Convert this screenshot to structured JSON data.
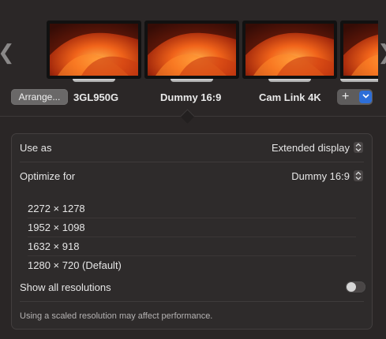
{
  "displays": {
    "items": [
      {
        "label": "3GL950G"
      },
      {
        "label": "Dummy 16:9"
      },
      {
        "label": "Cam Link 4K"
      }
    ],
    "arrange_label": "Arrange...",
    "add_symbol": "+",
    "left_arrow": "❮",
    "right_arrow": "❯",
    "selected": "Dummy 16:9"
  },
  "settings": {
    "use_as": {
      "label": "Use as",
      "value": "Extended display"
    },
    "optimize_for": {
      "label": "Optimize for",
      "value": "Dummy 16:9"
    },
    "resolutions": [
      "2272 × 1278",
      "1952 × 1098",
      "1632 × 918",
      "1280 × 720 (Default)"
    ],
    "show_all": {
      "label": "Show all resolutions",
      "enabled": false
    },
    "footnote": "Using a scaled resolution may affect performance."
  },
  "colors": {
    "accent": "#2d6ed8",
    "background": "#2a2626",
    "panel": "#2e2b2b"
  }
}
